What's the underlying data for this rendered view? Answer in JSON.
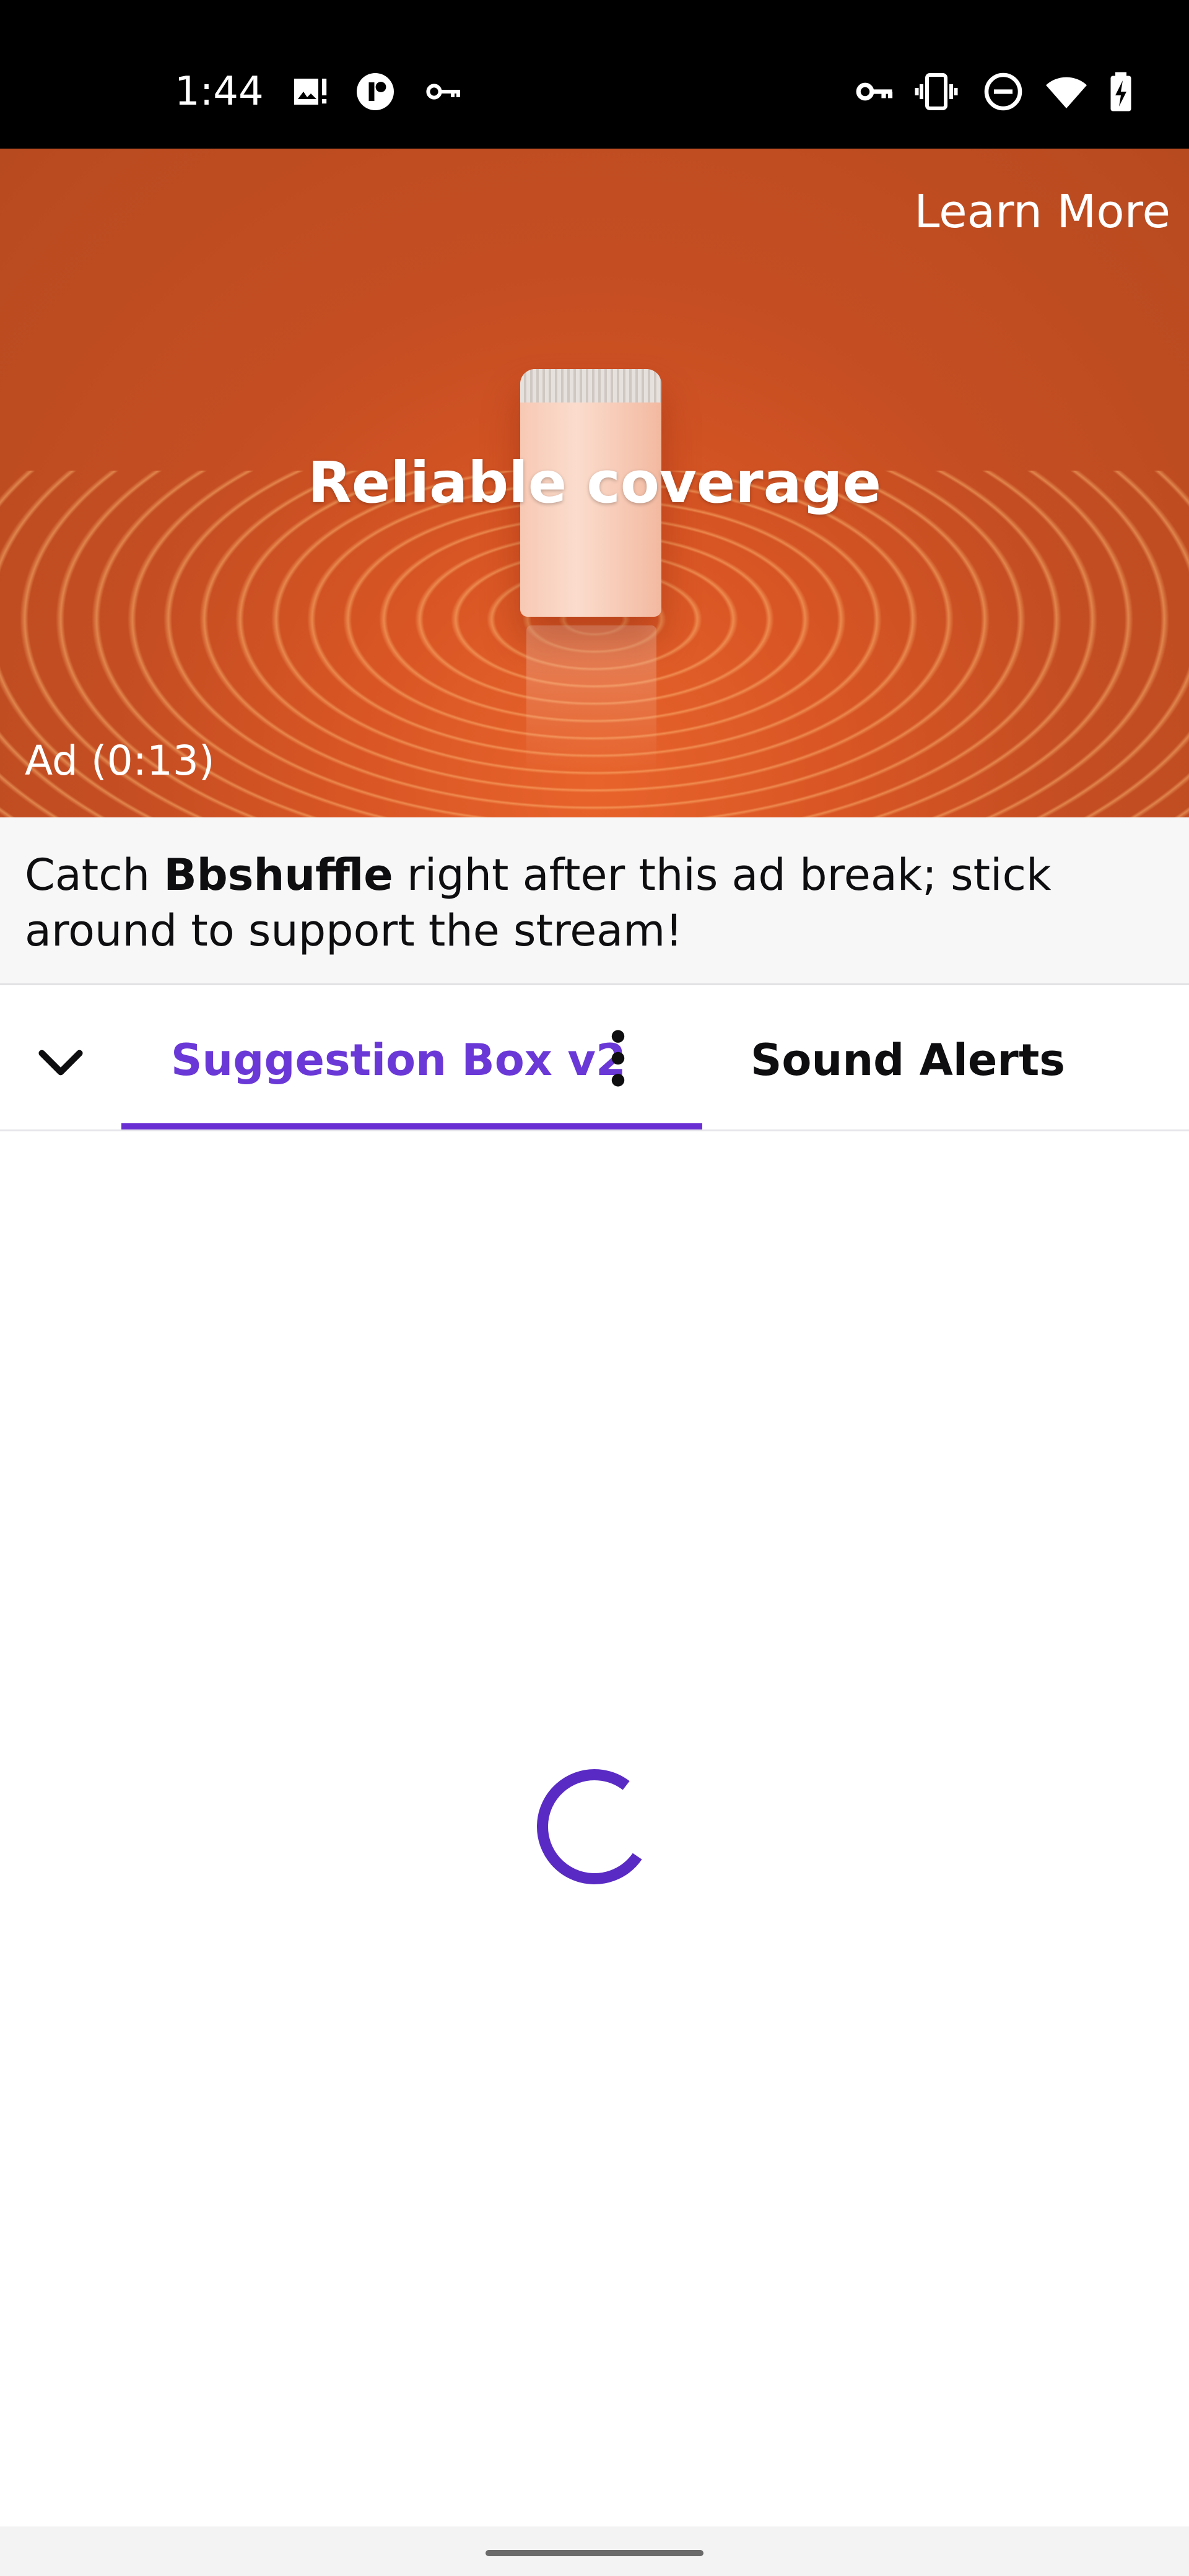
{
  "status_bar": {
    "time": "1:44",
    "left_icons": [
      "gallery-alert-icon",
      "app-circle-icon",
      "key-icon"
    ],
    "right_icons": [
      "vpn-key-icon",
      "vibrate-icon",
      "do-not-disturb-icon",
      "wifi-icon",
      "battery-charging-icon"
    ]
  },
  "ad": {
    "headline": "Reliable coverage",
    "learn_more": "Learn More",
    "timer": "Ad (0:13)",
    "background_color": "#c54e22"
  },
  "ad_banner": {
    "prefix": "Catch ",
    "channel": "Bbshuffle",
    "suffix": " right after this ad break; stick around to support the stream!"
  },
  "tabs": {
    "collapse_icon": "chevron-down-icon",
    "items": [
      {
        "label": "Suggestion Box v2",
        "active": true
      },
      {
        "label": "Sound Alerts",
        "active": false
      }
    ],
    "more_icon": "more-vertical-icon",
    "accent_color": "#6a2fd3"
  },
  "content": {
    "loading": true,
    "spinner_color": "#5a2bc4"
  }
}
